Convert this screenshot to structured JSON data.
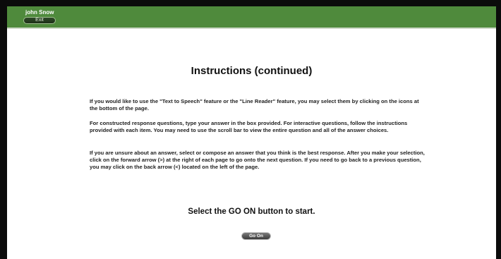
{
  "header": {
    "user_name": "john Snow",
    "exit_label": "Exit",
    "bar_color": "#4f8a3c"
  },
  "main": {
    "title": "Instructions (continued)",
    "paragraphs": [
      "If you would like to use the \"Text to Speech\" feature or the \"Line Reader\" feature, you may select them by clicking on the icons at the bottom of the page.",
      "For constructed response questions, type your answer in the box provided.  For interactive questions, follow the instructions provided with each item.  You may need to use the scroll bar to view the entire question and all of the answer choices.",
      "If you are unsure about an answer, select or compose an answer that you think is the best response.  After you make your selection, click on the forward arrow (>) at the right of each page to go onto the next question.  If you need to go back to a previous question, you may click on the back arrow (<) located on the left of the page."
    ],
    "start_text": "Select the GO ON button to start.",
    "go_on_label": "Go On"
  }
}
